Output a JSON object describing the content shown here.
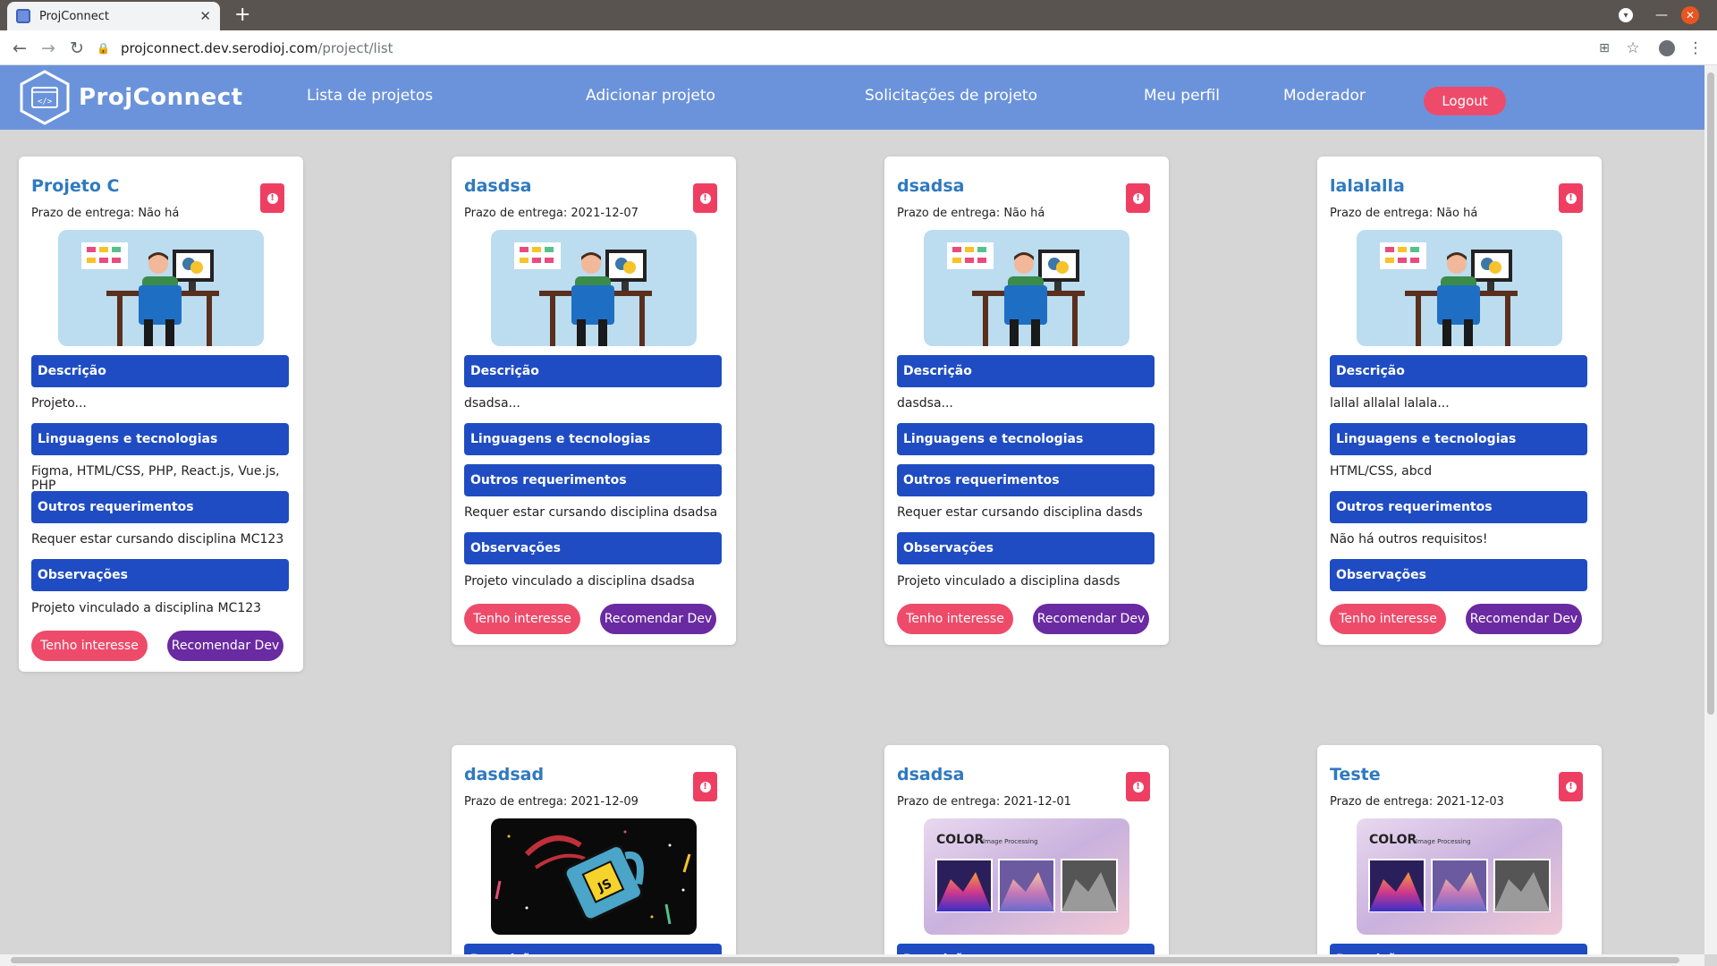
{
  "browser": {
    "tab_title": "ProjConnect",
    "url_host": "projconnect.dev.serodioj.com",
    "url_path": "/project/list"
  },
  "navbar": {
    "brand": "ProjConnect",
    "links": [
      "Lista de projetos",
      "Adicionar projeto",
      "Solicitações de projeto",
      "Meu perfil",
      "Moderador"
    ],
    "logout": "Logout"
  },
  "labels": {
    "description": "Descrição",
    "languages": "Linguagens e tecnologias",
    "requirements": "Outros requerimentos",
    "observations": "Observações",
    "interest": "Tenho interesse",
    "recommend": "Recomendar Dev"
  },
  "colors": {
    "navbar": "#6b93db",
    "section": "#1f4cc2",
    "title": "#2f79c0",
    "interest": "#ee4b6a",
    "recommend": "#6a2aa1"
  },
  "cards": [
    {
      "title": "Projeto C",
      "deadline": "Prazo de entrega: Não há",
      "image": "developer-illustration",
      "description": "Projeto...",
      "languages": "Figma, HTML/CSS, PHP, React.js, Vue.js, PHP",
      "requirements": "Requer estar cursando disciplina MC123",
      "observations": "Projeto vinculado a disciplina MC123"
    },
    {
      "title": "dasdsa",
      "deadline": "Prazo de entrega: 2021-12-07",
      "image": "developer-illustration",
      "description": "dsadsa...",
      "languages": "",
      "requirements": "Requer estar cursando disciplina dsadsa",
      "observations": "Projeto vinculado a disciplina dsadsa"
    },
    {
      "title": "dsadsa",
      "deadline": "Prazo de entrega: Não há",
      "image": "developer-illustration",
      "description": "dasdsa...",
      "languages": "",
      "requirements": "Requer estar cursando disciplina dasds",
      "observations": "Projeto vinculado a disciplina dasds"
    },
    {
      "title": "lalalalla",
      "deadline": "Prazo de entrega: Não há",
      "image": "developer-illustration",
      "description": "lallal allalal lalala...",
      "languages": "HTML/CSS, abcd",
      "requirements": "Não há outros requisitos!",
      "observations": ""
    },
    {
      "title": "dasdsad",
      "deadline": "Prazo de entrega: 2021-12-09",
      "image": "js-mug"
    },
    {
      "title": "dsadsa",
      "deadline": "Prazo de entrega: 2021-12-01",
      "image": "color-image-processing",
      "image_title": "COLOR",
      "image_subtitle": "Image Processing"
    },
    {
      "title": "Teste",
      "deadline": "Prazo de entrega: 2021-12-03",
      "image": "color-image-processing",
      "image_title": "COLOR",
      "image_subtitle": "Image Processing"
    }
  ]
}
